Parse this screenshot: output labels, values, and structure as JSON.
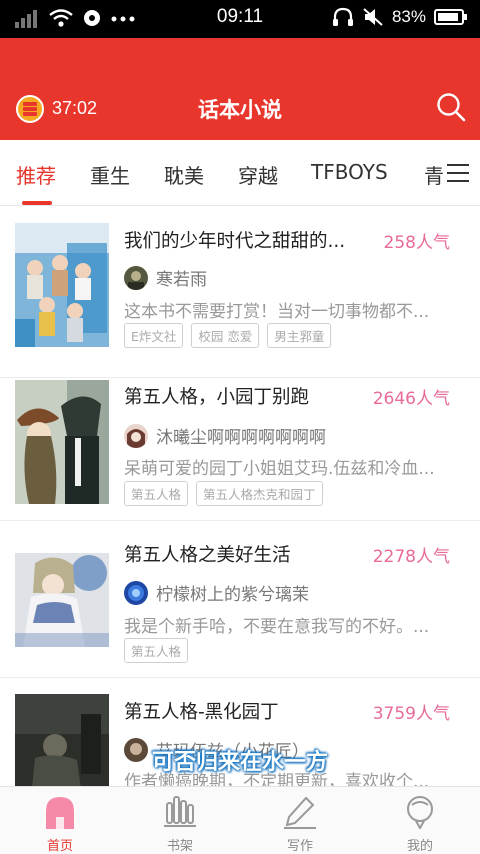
{
  "status_bar": {
    "time": "09:11",
    "battery": "83%"
  },
  "header": {
    "timer": "37:02",
    "title": "话本小说"
  },
  "tabs": [
    {
      "label": "推荐",
      "active": true
    },
    {
      "label": "重生"
    },
    {
      "label": "耽美"
    },
    {
      "label": "穿越"
    },
    {
      "label": "TFBOYS"
    },
    {
      "label": "青"
    }
  ],
  "books": [
    {
      "title": "我们的少年时代之甜甜的...",
      "popularity": "258人气",
      "author": "寒若雨",
      "desc": "这本书不需要打赏！当对一切事物都不...",
      "tags": [
        "E炸文社",
        "校园 恋爱",
        "男主郛童"
      ]
    },
    {
      "title": "第五人格，小园丁别跑",
      "popularity": "2646人气",
      "author": "沐曦尘啊啊啊啊啊啊啊",
      "desc": "呆萌可爱的园丁小姐姐艾玛.伍兹和冷血...",
      "tags": [
        "第五人格",
        "第五人格杰克和园丁"
      ]
    },
    {
      "title": "第五人格之美好生活",
      "popularity": "2278人气",
      "author": "柠檬树上的紫兮璃茉",
      "desc": "我是个新手哈，不要在意我写的不好。...",
      "tags": [
        "第五人格"
      ]
    },
    {
      "title": "第五人格-黑化园丁",
      "popularity": "3759人气",
      "author": "艾玛伍兹（小花匠）",
      "desc": "作者懒癌晚期，不定期更新，喜欢收个...",
      "tags": []
    }
  ],
  "subtitle": "可否归来在水一方",
  "bottom_nav": [
    {
      "label": "首页",
      "active": true
    },
    {
      "label": "书架"
    },
    {
      "label": "写作"
    },
    {
      "label": "我的"
    }
  ],
  "colors": {
    "brand_red": "#e8362d",
    "popularity_pink": "#e86a9a"
  }
}
